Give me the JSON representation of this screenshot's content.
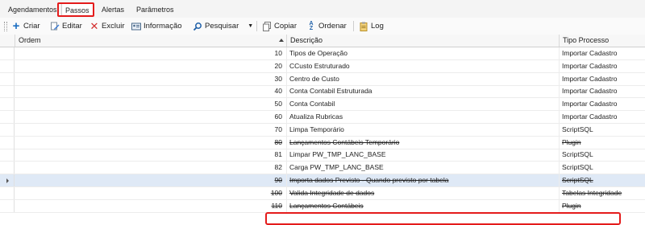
{
  "tabs": [
    {
      "label": "Agendamentos"
    },
    {
      "label": "Passos"
    },
    {
      "label": "Alertas"
    },
    {
      "label": "Parâmetros"
    }
  ],
  "toolbar": {
    "criar": "Criar",
    "editar": "Editar",
    "excluir": "Excluir",
    "informacao": "Informação",
    "pesquisar": "Pesquisar",
    "copiar": "Copiar",
    "ordenar": "Ordenar",
    "log": "Log"
  },
  "grid": {
    "columns": {
      "ordem": "Ordem",
      "descricao": "Descrição",
      "tipo": "Tipo Processo"
    },
    "rows": [
      {
        "ordem": "10",
        "descricao": "Tipos de Operação",
        "tipo": "Importar Cadastro",
        "struck": false
      },
      {
        "ordem": "20",
        "descricao": "CCusto Estruturado",
        "tipo": "Importar Cadastro",
        "struck": false
      },
      {
        "ordem": "30",
        "descricao": "Centro de Custo",
        "tipo": "Importar Cadastro",
        "struck": false
      },
      {
        "ordem": "40",
        "descricao": "Conta Contabil Estruturada",
        "tipo": "Importar Cadastro",
        "struck": false
      },
      {
        "ordem": "50",
        "descricao": "Conta Contabil",
        "tipo": "Importar Cadastro",
        "struck": false
      },
      {
        "ordem": "60",
        "descricao": "Atualiza Rubricas",
        "tipo": "Importar Cadastro",
        "struck": false
      },
      {
        "ordem": "70",
        "descricao": "Limpa Temporário",
        "tipo": "ScriptSQL",
        "struck": false
      },
      {
        "ordem": "80",
        "descricao": "Lançamentos Contábeis Temporário",
        "tipo": "Plugin",
        "struck": true
      },
      {
        "ordem": "81",
        "descricao": "Limpar PW_TMP_LANC_BASE",
        "tipo": "ScriptSQL",
        "struck": false
      },
      {
        "ordem": "82",
        "descricao": "Carga PW_TMP_LANC_BASE",
        "tipo": "ScriptSQL",
        "struck": false
      },
      {
        "ordem": "90",
        "descricao": "Importa dados Previsto - Quando previsto por tabela",
        "tipo": "ScriptSQL",
        "struck": true
      },
      {
        "ordem": "100",
        "descricao": "Valida Integridade de dados",
        "tipo": "Tabelas Integridade",
        "struck": true
      },
      {
        "ordem": "110",
        "descricao": "Lançamentos Contábeis",
        "tipo": "Plugin",
        "struck": true
      }
    ],
    "selected_row": 10
  }
}
